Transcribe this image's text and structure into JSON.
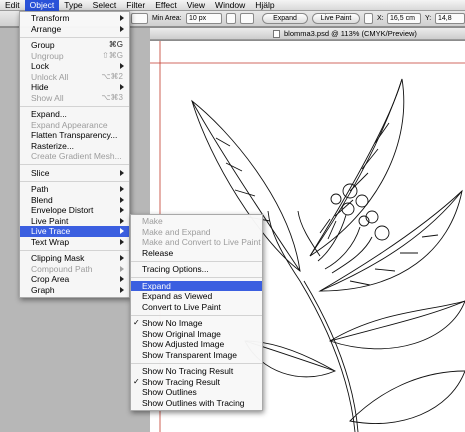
{
  "menubar": {
    "items": [
      {
        "label": "Edit"
      },
      {
        "label": "Object",
        "active": true
      },
      {
        "label": "Type"
      },
      {
        "label": "Select"
      },
      {
        "label": "Filter"
      },
      {
        "label": "Effect"
      },
      {
        "label": "View"
      },
      {
        "label": "Window"
      },
      {
        "label": "Hjälp"
      }
    ]
  },
  "controlbar": {
    "min_area_label": "Min Area:",
    "min_area_value": "10 px",
    "expand_button": "Expand",
    "live_paint_button": "Live Paint",
    "x_label": "X:",
    "x_value": "16,5 cm",
    "y_label": "Y:",
    "y_value": "14,8"
  },
  "document": {
    "title": "blomma3.psd @ 113% (CMYK/Preview)"
  },
  "object_menu": {
    "items": [
      {
        "type": "item",
        "label": "Transform",
        "submenu": true
      },
      {
        "type": "item",
        "label": "Arrange",
        "submenu": true
      },
      {
        "type": "sep"
      },
      {
        "type": "item",
        "label": "Group",
        "shortcut": "⌘G"
      },
      {
        "type": "item",
        "label": "Ungroup",
        "shortcut": "⇧⌘G",
        "disabled": true
      },
      {
        "type": "item",
        "label": "Lock",
        "submenu": true
      },
      {
        "type": "item",
        "label": "Unlock All",
        "shortcut": "⌥⌘2",
        "disabled": true
      },
      {
        "type": "item",
        "label": "Hide",
        "submenu": true
      },
      {
        "type": "item",
        "label": "Show All",
        "shortcut": "⌥⌘3",
        "disabled": true
      },
      {
        "type": "sep"
      },
      {
        "type": "item",
        "label": "Expand..."
      },
      {
        "type": "item",
        "label": "Expand Appearance",
        "disabled": true
      },
      {
        "type": "item",
        "label": "Flatten Transparency..."
      },
      {
        "type": "item",
        "label": "Rasterize..."
      },
      {
        "type": "item",
        "label": "Create Gradient Mesh...",
        "disabled": true
      },
      {
        "type": "sep"
      },
      {
        "type": "item",
        "label": "Slice",
        "submenu": true
      },
      {
        "type": "sep"
      },
      {
        "type": "item",
        "label": "Path",
        "submenu": true
      },
      {
        "type": "item",
        "label": "Blend",
        "submenu": true
      },
      {
        "type": "item",
        "label": "Envelope Distort",
        "submenu": true
      },
      {
        "type": "item",
        "label": "Live Paint",
        "submenu": true
      },
      {
        "type": "item",
        "label": "Live Trace",
        "submenu": true,
        "highlight": true
      },
      {
        "type": "item",
        "label": "Text Wrap",
        "submenu": true
      },
      {
        "type": "sep"
      },
      {
        "type": "item",
        "label": "Clipping Mask",
        "submenu": true
      },
      {
        "type": "item",
        "label": "Compound Path",
        "submenu": true,
        "disabled": true
      },
      {
        "type": "item",
        "label": "Crop Area",
        "submenu": true
      },
      {
        "type": "item",
        "label": "Graph",
        "submenu": true
      }
    ]
  },
  "live_trace_menu": {
    "items": [
      {
        "type": "item",
        "label": "Make",
        "disabled": true
      },
      {
        "type": "item",
        "label": "Make and Expand",
        "disabled": true
      },
      {
        "type": "item",
        "label": "Make and Convert to Live Paint",
        "disabled": true
      },
      {
        "type": "item",
        "label": "Release"
      },
      {
        "type": "sep"
      },
      {
        "type": "item",
        "label": "Tracing Options..."
      },
      {
        "type": "sep"
      },
      {
        "type": "item",
        "label": "Expand",
        "highlight": true
      },
      {
        "type": "item",
        "label": "Expand as Viewed"
      },
      {
        "type": "item",
        "label": "Convert to Live Paint"
      },
      {
        "type": "sep"
      },
      {
        "type": "item",
        "label": "Show No Image",
        "checked": true
      },
      {
        "type": "item",
        "label": "Show Original Image"
      },
      {
        "type": "item",
        "label": "Show Adjusted Image"
      },
      {
        "type": "item",
        "label": "Show Transparent Image"
      },
      {
        "type": "sep"
      },
      {
        "type": "item",
        "label": "Show No Tracing Result"
      },
      {
        "type": "item",
        "label": "Show Tracing Result",
        "checked": true
      },
      {
        "type": "item",
        "label": "Show Outlines"
      },
      {
        "type": "item",
        "label": "Show Outlines with Tracing"
      }
    ]
  },
  "colors": {
    "highlight": "#3b5fe0",
    "menu_active": "#2a52d8",
    "guide_line": "#c0392b"
  }
}
